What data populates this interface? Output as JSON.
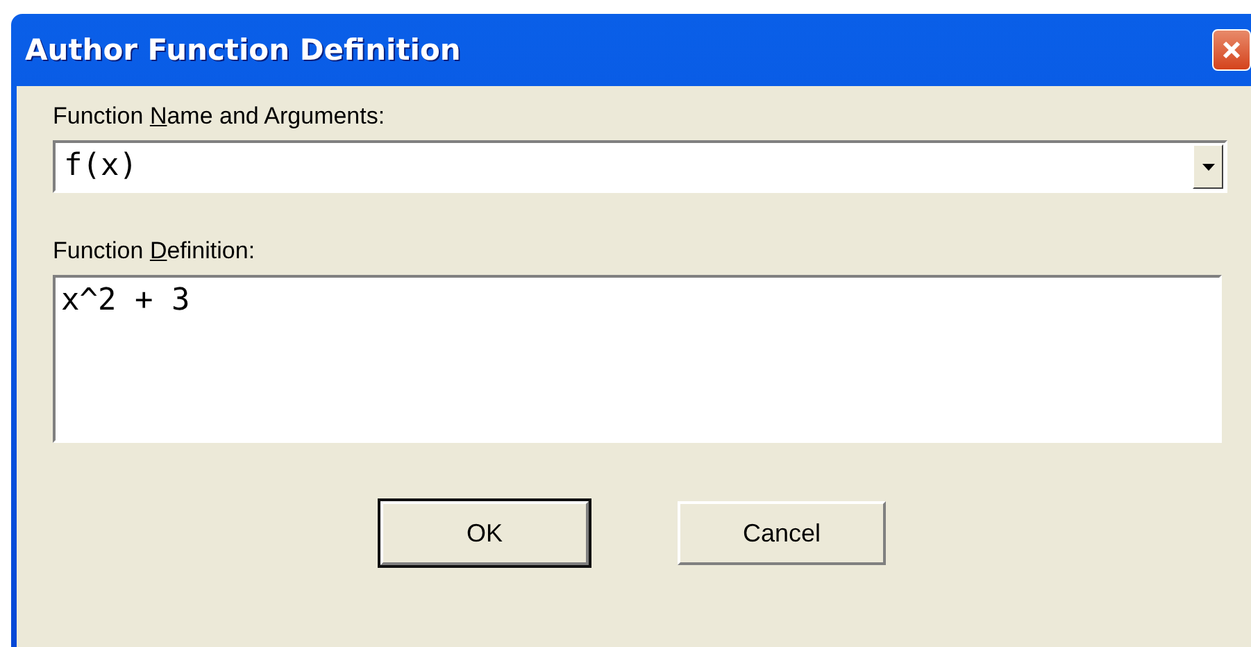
{
  "window": {
    "title": "Author Function Definition"
  },
  "name_field": {
    "label": {
      "before": "Function ",
      "mnemonic": "N",
      "after": "ame and Arguments:"
    },
    "value": "f(x)"
  },
  "definition_field": {
    "label": {
      "before": "Function ",
      "mnemonic": "D",
      "after": "efinition:"
    },
    "value": "x^2 + 3"
  },
  "buttons": [
    {
      "label": "OK",
      "default": true
    },
    {
      "label": "Cancel",
      "default": false
    }
  ]
}
